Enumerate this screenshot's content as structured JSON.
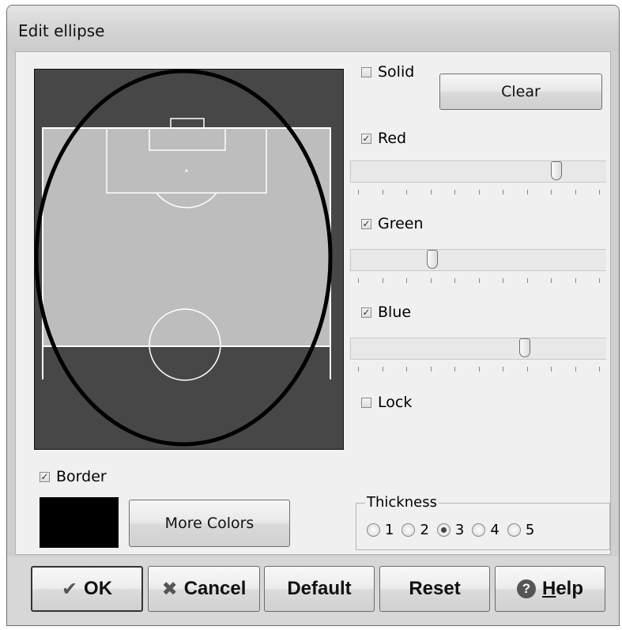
{
  "window": {
    "title": "Edit ellipse"
  },
  "options": {
    "solid_label": "Solid",
    "solid_checked": false,
    "clear_label": "Clear",
    "red_label": "Red",
    "red_checked": true,
    "green_label": "Green",
    "green_checked": true,
    "blue_label": "Blue",
    "blue_checked": true,
    "lock_label": "Lock",
    "lock_checked": false,
    "border_label": "Border",
    "border_checked": true,
    "more_colors_label": "More Colors"
  },
  "sliders": {
    "red_fraction": 0.82,
    "green_fraction": 0.31,
    "blue_fraction": 0.69
  },
  "border_color": "#000000",
  "thickness": {
    "label": "Thickness",
    "options": [
      "1",
      "2",
      "3",
      "4",
      "5"
    ],
    "selected": "3"
  },
  "footer": {
    "ok_label": "OK",
    "cancel_label": "Cancel",
    "default_label": "Default",
    "reset_label": "Reset",
    "help_label": "Help"
  },
  "icons": {
    "ok": "checkmark-icon",
    "cancel": "x-icon",
    "help": "help-icon"
  }
}
